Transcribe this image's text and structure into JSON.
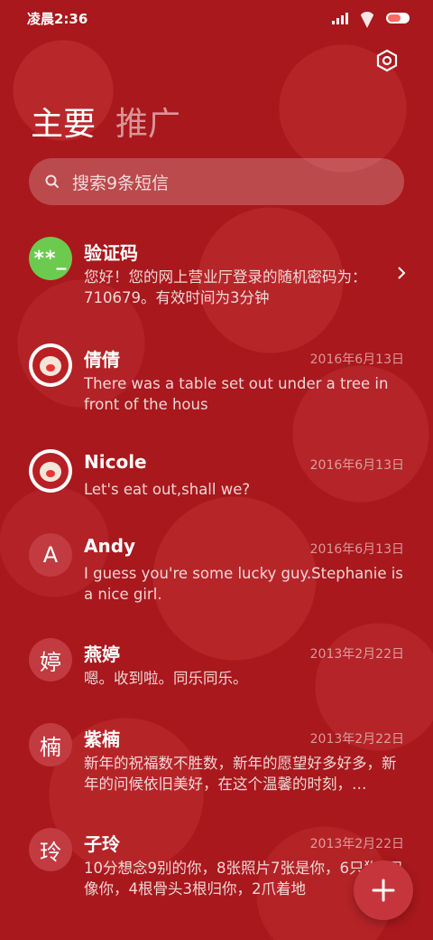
{
  "status_bar": {
    "time": "凌晨2:36"
  },
  "tabs": [
    {
      "label": "主要"
    },
    {
      "label": "推广"
    }
  ],
  "search": {
    "placeholder": "搜索9条短信"
  },
  "conversations": [
    {
      "avatar_text": "**_",
      "name": "验证码",
      "date": "",
      "message": "您好！您的网上营业厅登录的随机密码为：710679。有效时间为3分钟"
    },
    {
      "avatar_text": "",
      "name": "倩倩",
      "date": "2016年6月13日",
      "message": "There was a table set out under a tree in front of the hous"
    },
    {
      "avatar_text": "",
      "name": "Nicole",
      "date": "2016年6月13日",
      "message": "Let's eat out,shall we?"
    },
    {
      "avatar_text": "A",
      "name": "Andy",
      "date": "2016年6月13日",
      "message": "I guess you're some lucky guy.Stephanie is a nice girl."
    },
    {
      "avatar_text": "婷",
      "name": "燕婷",
      "date": "2013年2月22日",
      "message": "嗯。收到啦。同乐同乐。"
    },
    {
      "avatar_text": "楠",
      "name": "紫楠",
      "date": "2013年2月22日",
      "message": "新年的祝福数不胜数，新年的愿望好多好多，新年的问候依旧美好，在这个温馨的时刻，…"
    },
    {
      "avatar_text": "玲",
      "name": "子玲",
      "date": "2013年2月22日",
      "message": "10分想念9别的你，8张照片7张是你，6只狗5只像你，4根骨头3根归你，2爪着地"
    }
  ],
  "colors": {
    "background": "#a8181c",
    "avatar_letter": "#c23b41",
    "avatar_code": "#6ccb4e",
    "fab": "#c7353c"
  },
  "icons": [
    "signal-icon",
    "wifi-icon",
    "battery-icon",
    "settings-icon",
    "search-icon",
    "chevron-right-icon",
    "plus-icon"
  ]
}
